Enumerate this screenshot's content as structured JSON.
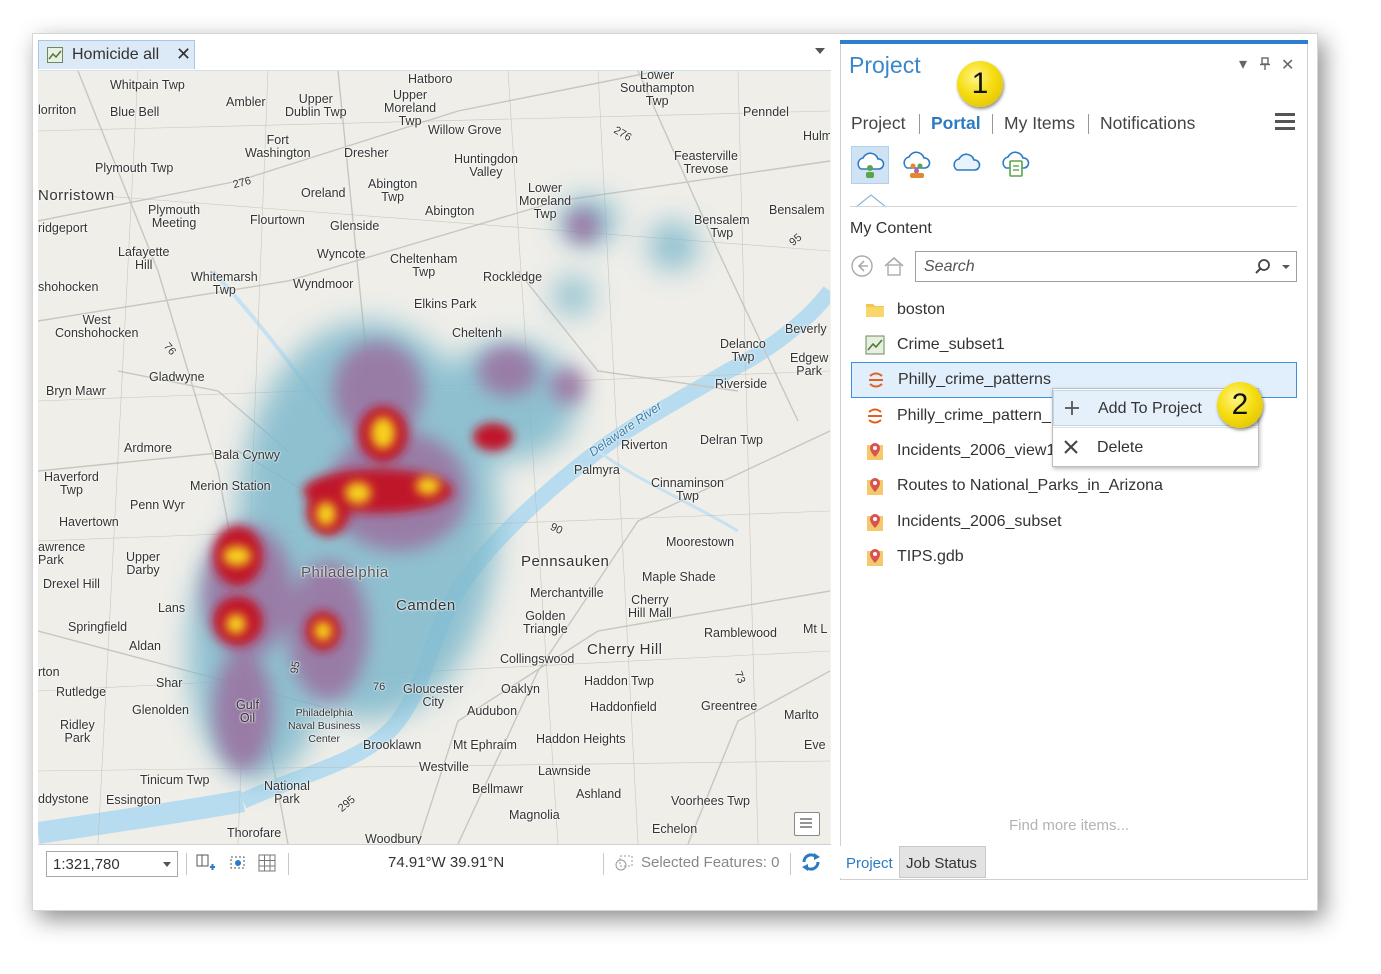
{
  "map_view": {
    "tab_title": "Homicide all",
    "tab_close": "✕",
    "places": [
      {
        "name": "Whitpain Twp"
      },
      {
        "name": "Ambler"
      },
      {
        "name": "Upper\nDublin Twp"
      },
      {
        "name": "Hatboro"
      },
      {
        "name": "Upper\nMoreland\nTwp"
      },
      {
        "name": "Lower\nSouthampton\nTwp"
      },
      {
        "name": "Penndel"
      },
      {
        "name": "Hulmevi"
      },
      {
        "name": "Blue Bell"
      },
      {
        "name": "lorriton"
      },
      {
        "name": "Willow Grove"
      },
      {
        "name": "Fort\nWashington"
      },
      {
        "name": "Dresher"
      },
      {
        "name": "Huntingdon\nValley"
      },
      {
        "name": "Feasterville\nTrevose"
      },
      {
        "name": "Plymouth Twp"
      },
      {
        "name": "Abington\nTwp"
      },
      {
        "name": "Lower\nMoreland\nTwp"
      },
      {
        "name": "Norristown"
      },
      {
        "name": "Oreland"
      },
      {
        "name": "Plymouth\nMeeting"
      },
      {
        "name": "Abington"
      },
      {
        "name": "Bensalem\nTwp"
      },
      {
        "name": "Bensalem"
      },
      {
        "name": "ridgeport"
      },
      {
        "name": "Flourtown"
      },
      {
        "name": "Glenside"
      },
      {
        "name": "Lafayette\nHill"
      },
      {
        "name": "Wyncote"
      },
      {
        "name": "Cheltenham\nTwp"
      },
      {
        "name": "Rockledge"
      },
      {
        "name": "Whitemarsh\nTwp"
      },
      {
        "name": "Wyndmoor"
      },
      {
        "name": "shohocken"
      },
      {
        "name": "Elkins Park"
      },
      {
        "name": "West\nConshohocken"
      },
      {
        "name": "Cheltenh"
      },
      {
        "name": "Beverly"
      },
      {
        "name": "Delanco\nTwp"
      },
      {
        "name": "Edgew\nPark"
      },
      {
        "name": "Riverside"
      },
      {
        "name": "Gladwyne"
      },
      {
        "name": "Bryn Mawr"
      },
      {
        "name": "Riverton"
      },
      {
        "name": "Delran Twp"
      },
      {
        "name": "Ardmore"
      },
      {
        "name": "Bala Cynwy"
      },
      {
        "name": "Palmyra"
      },
      {
        "name": "Haverford\nTwp"
      },
      {
        "name": "Merion Station"
      },
      {
        "name": "Cinnaminson\nTwp"
      },
      {
        "name": "Penn Wyr"
      },
      {
        "name": "Havertown"
      },
      {
        "name": "awrence\nPark"
      },
      {
        "name": "Upper\nDarby"
      },
      {
        "name": "Moorestown"
      },
      {
        "name": "Pennsauken"
      },
      {
        "name": "Drexel Hill"
      },
      {
        "name": "Maple Shade"
      },
      {
        "name": "Lans"
      },
      {
        "name": "Merchantville"
      },
      {
        "name": "Camden"
      },
      {
        "name": "Cherry\nHill Mall"
      },
      {
        "name": "Springfield"
      },
      {
        "name": "Golden\nTriangle"
      },
      {
        "name": "Ramblewood"
      },
      {
        "name": "Mt L"
      },
      {
        "name": "Aldan"
      },
      {
        "name": "Cherry Hill"
      },
      {
        "name": "Collingswood"
      },
      {
        "name": "rton"
      },
      {
        "name": "Shar"
      },
      {
        "name": "Haddon Twp"
      },
      {
        "name": "Rutledge"
      },
      {
        "name": "Gloucester\nCity"
      },
      {
        "name": "Oaklyn"
      },
      {
        "name": "Audubon"
      },
      {
        "name": "Glenolden"
      },
      {
        "name": "Haddonfield"
      },
      {
        "name": "Greentree"
      },
      {
        "name": "Marlto"
      },
      {
        "name": "Ridley\nPark"
      },
      {
        "name": "Philadelphia\nNaval Business\nCenter"
      },
      {
        "name": "Brooklawn"
      },
      {
        "name": "Mt Ephraim"
      },
      {
        "name": "Haddon Heights"
      },
      {
        "name": "Eve"
      },
      {
        "name": "Westville"
      },
      {
        "name": "Lawnside"
      },
      {
        "name": "Tinicum Twp"
      },
      {
        "name": "Bellmawr"
      },
      {
        "name": "Ashland"
      },
      {
        "name": "National\nPark"
      },
      {
        "name": "Voorhees Twp"
      },
      {
        "name": "ddystone"
      },
      {
        "name": "Essington"
      },
      {
        "name": "Magnolia"
      },
      {
        "name": "Echelon"
      },
      {
        "name": "Thorofare"
      },
      {
        "name": "Woodbury"
      },
      {
        "name": "Philadelphia"
      },
      {
        "name": "Delaware River"
      },
      {
        "name": "Gulf\nOil"
      }
    ],
    "route_shields": [
      "276",
      "276",
      "95",
      "76",
      "90",
      "76",
      "295",
      "73",
      "95"
    ],
    "status_bar": {
      "scale": "1:321,780",
      "coordinates": "74.91°W 39.91°N",
      "selected_features": "Selected Features: 0"
    }
  },
  "project_pane": {
    "title": "Project",
    "controls": {
      "dropdown": "▾",
      "pin": "📌",
      "close": "✕"
    },
    "tabs": [
      "Project",
      "Portal",
      "My Items",
      "Notifications"
    ],
    "active_tab": "Portal",
    "portal_buttons": [
      "my-content-icon",
      "groups-icon",
      "all-portal-icon",
      "living-atlas-icon"
    ],
    "section_title": "My Content",
    "search": {
      "placeholder": "Search"
    },
    "items": [
      {
        "label": "boston",
        "icon": "folder-icon"
      },
      {
        "label": "Crime_subset1",
        "icon": "map-icon"
      },
      {
        "label": "Philly_crime_patterns",
        "icon": "layer-package-icon",
        "selected": true
      },
      {
        "label": "Philly_crime_pattern_",
        "icon": "layer-package-icon"
      },
      {
        "label": "Incidents_2006_view1",
        "icon": "feature-layer-icon"
      },
      {
        "label": "Routes to National_Parks_in_Arizona",
        "icon": "feature-layer-icon"
      },
      {
        "label": "Incidents_2006_subset",
        "icon": "feature-layer-icon"
      },
      {
        "label": "TIPS.gdb",
        "icon": "feature-layer-icon"
      }
    ],
    "context_menu": [
      {
        "label": "Add To Project",
        "icon": "plus-icon"
      },
      {
        "label": "Delete",
        "icon": "x-icon"
      }
    ],
    "find_more": "Find more items...",
    "bottom_tabs": [
      "Project",
      "Job Status"
    ]
  },
  "callouts": [
    "1",
    "2"
  ],
  "colors": {
    "accent": "#2b7bc4",
    "badge": "#f6dd10",
    "selection": "#e1eefb"
  }
}
